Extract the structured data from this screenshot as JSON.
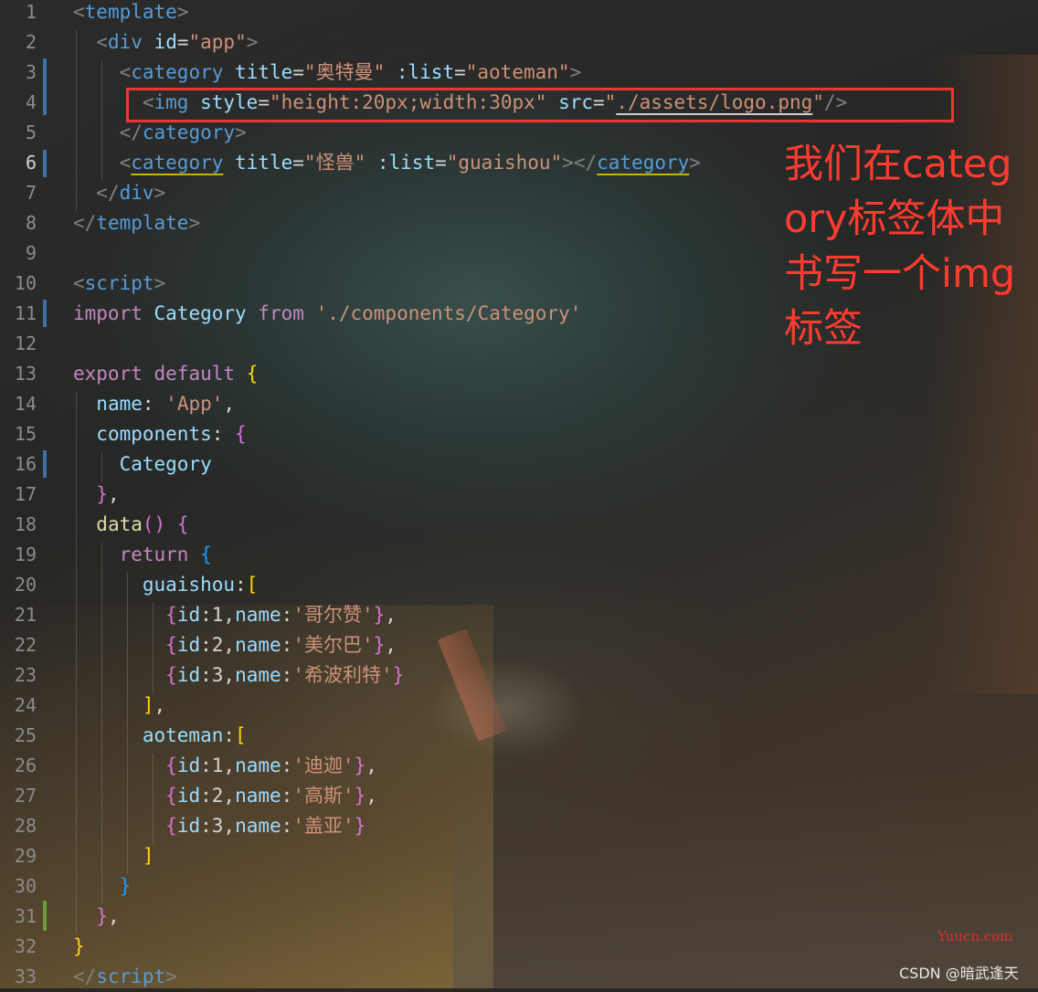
{
  "line_numbers": [
    "1",
    "2",
    "3",
    "4",
    "5",
    "6",
    "7",
    "8",
    "9",
    "10",
    "11",
    "12",
    "13",
    "14",
    "15",
    "16",
    "17",
    "18",
    "19",
    "20",
    "21",
    "22",
    "23",
    "24",
    "25",
    "26",
    "27",
    "28",
    "29",
    "30",
    "31",
    "32",
    "33"
  ],
  "code": {
    "template_open": "template",
    "div_tag": "div",
    "id_attr": "id",
    "app_val": "\"app\"",
    "category_tag": "category",
    "title_attr": "title",
    "title_aoteman": "\"奥特曼\"",
    "list_attr": ":list",
    "list_aoteman": "\"aoteman\"",
    "img_tag": "img",
    "style_attr": "style",
    "style_val": "\"height:20px;width:30px\"",
    "src_attr": "src",
    "src_quote": "\"",
    "src_path": "./assets/logo.png",
    "title_guaishou": "\"怪兽\"",
    "list_guaishou": "\"guaishou\"",
    "script_tag": "script",
    "kw_import": "import",
    "cls_category": "Category",
    "kw_from": "from",
    "import_path": "'./components/Category'",
    "kw_export": "export",
    "kw_default": "default",
    "prop_name": "name",
    "app_name_str": "'App'",
    "prop_components": "components",
    "fn_data": "data",
    "kw_return": "return",
    "prop_guaishou": "guaishou",
    "prop_aoteman": "aoteman",
    "prop_id": "id",
    "n1": "1",
    "n2": "2",
    "n3": "3",
    "gs1": "'哥尔赞'",
    "gs2": "'美尔巴'",
    "gs3": "'希波利特'",
    "at1": "'迪迦'",
    "at2": "'高斯'",
    "at3": "'盖亚'"
  },
  "annotation": {
    "text": "我们在category标签体中书写一个img标签"
  },
  "watermarks": {
    "yuucn": "Yuucn.com",
    "csdn": "CSDN @暗武逢天"
  },
  "colors": {
    "annotation": "#ff3b30",
    "highlight_box": "#e53935",
    "tag": "#569cd6",
    "attribute": "#9cdcfe",
    "string": "#ce9178",
    "keyword": "#c586c0",
    "class": "#4ec9b0"
  }
}
